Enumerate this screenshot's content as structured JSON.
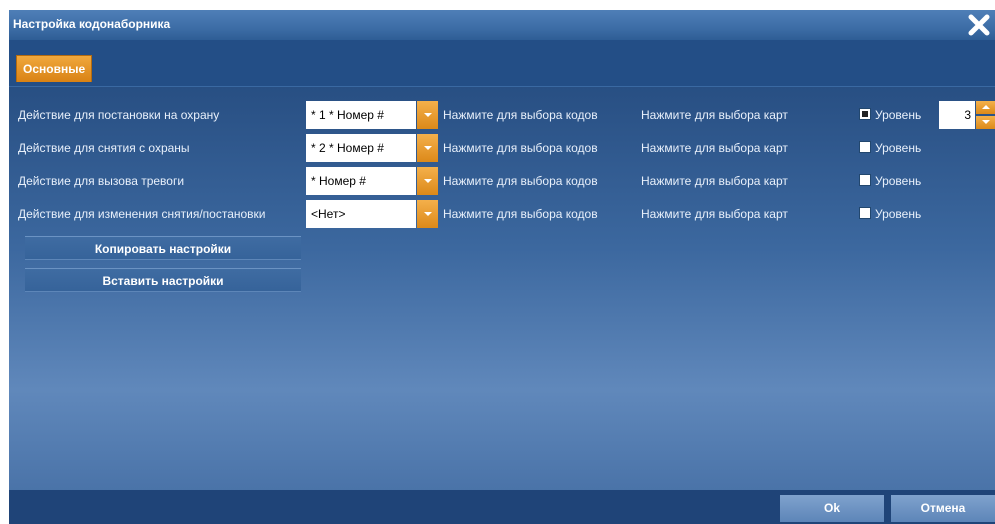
{
  "window": {
    "title": "Настройка кодонаборника",
    "accent": "#e08d1e",
    "bg": "#2f5f96"
  },
  "tabs": [
    {
      "label": "Основные",
      "active": true
    }
  ],
  "rows": [
    {
      "label": "Действие для постановки на охрану",
      "value": "* 1 * Номер #",
      "codes_link": "Нажмите для выбора кодов",
      "cards_link": "Нажмите для выбора карт",
      "level_checked": true,
      "level_label": "Уровень",
      "level_value": "3"
    },
    {
      "label": "Действие для снятия с охраны",
      "value": "* 2 * Номер #",
      "codes_link": "Нажмите для выбора кодов",
      "cards_link": "Нажмите для выбора карт",
      "level_checked": false,
      "level_label": "Уровень"
    },
    {
      "label": "Действие для вызова тревоги",
      "value": "* Номер #",
      "codes_link": "Нажмите для выбора кодов",
      "cards_link": "Нажмите для выбора карт",
      "level_checked": false,
      "level_label": "Уровень"
    },
    {
      "label": "Действие для изменения снятия/постановки",
      "value": "<Нет>",
      "codes_link": "Нажмите для выбора кодов",
      "cards_link": "Нажмите для выбора карт",
      "level_checked": false,
      "level_label": "Уровень"
    }
  ],
  "actions": {
    "copy_label": "Копировать настройки",
    "paste_label": "Вставить настройки"
  },
  "footer": {
    "ok_label": "Ok",
    "cancel_label": "Отмена"
  },
  "icons": {
    "close": "close-icon",
    "dropdown": "chevron-down-icon",
    "spin_up": "chevron-up-icon",
    "spin_down": "chevron-down-icon"
  }
}
